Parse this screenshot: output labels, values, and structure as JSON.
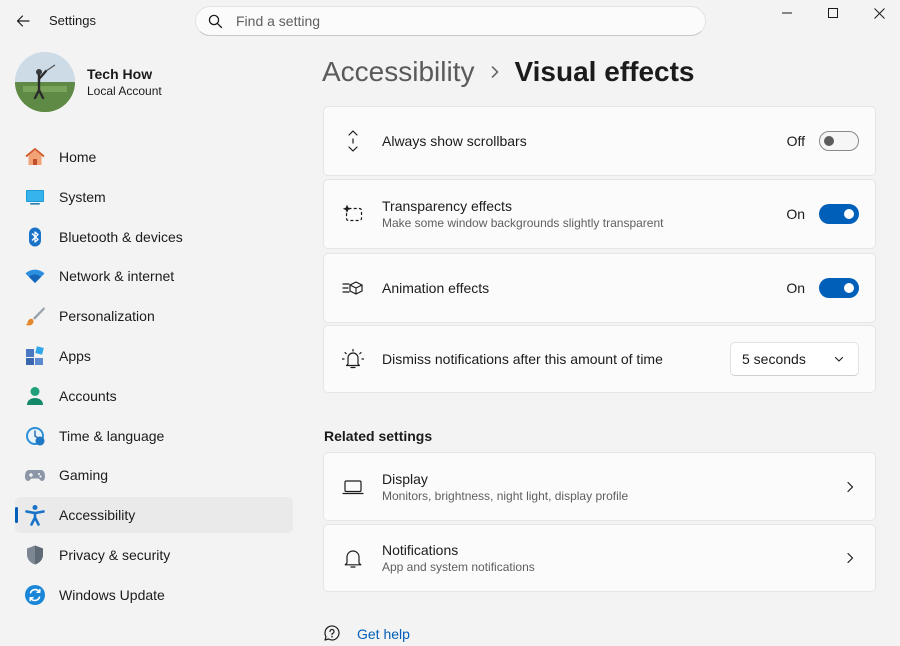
{
  "app": {
    "title": "Settings"
  },
  "search": {
    "placeholder": "Find a setting"
  },
  "profile": {
    "name": "Tech How",
    "account_type": "Local Account"
  },
  "sidebar": {
    "items": [
      {
        "label": "Home",
        "icon": "home-icon"
      },
      {
        "label": "System",
        "icon": "system-icon"
      },
      {
        "label": "Bluetooth & devices",
        "icon": "bluetooth-icon"
      },
      {
        "label": "Network & internet",
        "icon": "wifi-icon"
      },
      {
        "label": "Personalization",
        "icon": "brush-icon"
      },
      {
        "label": "Apps",
        "icon": "apps-icon"
      },
      {
        "label": "Accounts",
        "icon": "accounts-icon"
      },
      {
        "label": "Time & language",
        "icon": "clock-globe-icon"
      },
      {
        "label": "Gaming",
        "icon": "gamepad-icon"
      },
      {
        "label": "Accessibility",
        "icon": "accessibility-icon",
        "active": true
      },
      {
        "label": "Privacy & security",
        "icon": "shield-icon"
      },
      {
        "label": "Windows Update",
        "icon": "update-icon"
      }
    ]
  },
  "breadcrumb": {
    "parent": "Accessibility",
    "current": "Visual effects"
  },
  "settings": {
    "scrollbars": {
      "title": "Always show scrollbars",
      "state": "Off",
      "icon": "scroll-arrows-icon"
    },
    "transparency": {
      "title": "Transparency effects",
      "description": "Make some window backgrounds slightly transparent",
      "state": "On",
      "icon": "transparency-icon"
    },
    "animation": {
      "title": "Animation effects",
      "state": "On",
      "icon": "animation-icon"
    },
    "notifications_timeout": {
      "title": "Dismiss notifications after this amount of time",
      "value": "5 seconds",
      "icon": "notification-bell-icon"
    }
  },
  "related": {
    "title": "Related settings",
    "display": {
      "title": "Display",
      "description": "Monitors, brightness, night light, display profile",
      "icon": "laptop-icon"
    },
    "notifications": {
      "title": "Notifications",
      "description": "App and system notifications",
      "icon": "bell-icon"
    }
  },
  "help": {
    "label": "Get help"
  },
  "colors": {
    "accent": "#005fb8",
    "background": "#f3f3f3",
    "card": "#fbfbfb",
    "active_nav": "#eaeaea"
  }
}
